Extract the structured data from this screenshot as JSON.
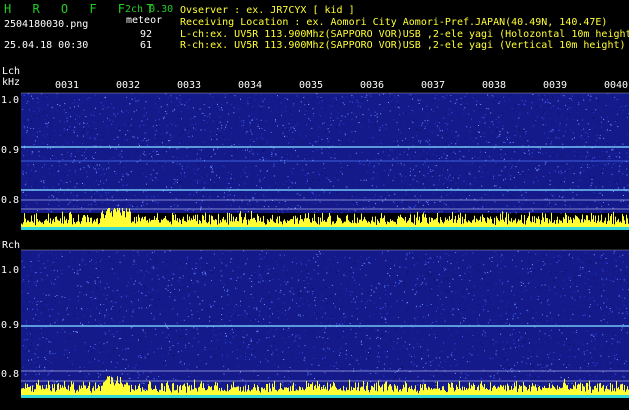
{
  "header": {
    "logo": "H R O F F T",
    "mode": "2ch 0.30",
    "filename": "2504180030.png",
    "datetime": "25.04.18 00:30",
    "counter_label": "meteor",
    "count_l": "92",
    "count_r": "61",
    "observer_line": "Ovserver           : ex. JR7CYX [ kid ]",
    "location_line": "Receiving Location : ex. Aomori City Aomori-Pref.JAPAN(40.49N, 140.47E)",
    "lch_line": "L-ch:ex. UV5R 113.900Mhz(SAPPORO VOR)USB ,2-ele yagi (Holozontal 10m height)",
    "rch_line": "R-ch:ex. UV5R 113.900Mhz(SAPPORO VOR)USB ,2-ele yagi (Vertical 10m height)"
  },
  "time_ticks": [
    "0031",
    "0032",
    "0033",
    "0034",
    "0035",
    "0036",
    "0037",
    "0038",
    "0039",
    "0040"
  ],
  "lch": {
    "label": "Lch",
    "unit": "kHz",
    "freq_labels": [
      "1.0",
      "0.9",
      "0.8"
    ]
  },
  "rch": {
    "label": "Rch",
    "freq_labels": [
      "1.0",
      "0.9",
      "0.8"
    ]
  },
  "colors": {
    "bg": "#000000",
    "noise_bg": "#141a8a",
    "text_green": "#22cc22",
    "signal_yellow": "#ffff33",
    "signal_cyan": "#33d6d6"
  }
}
